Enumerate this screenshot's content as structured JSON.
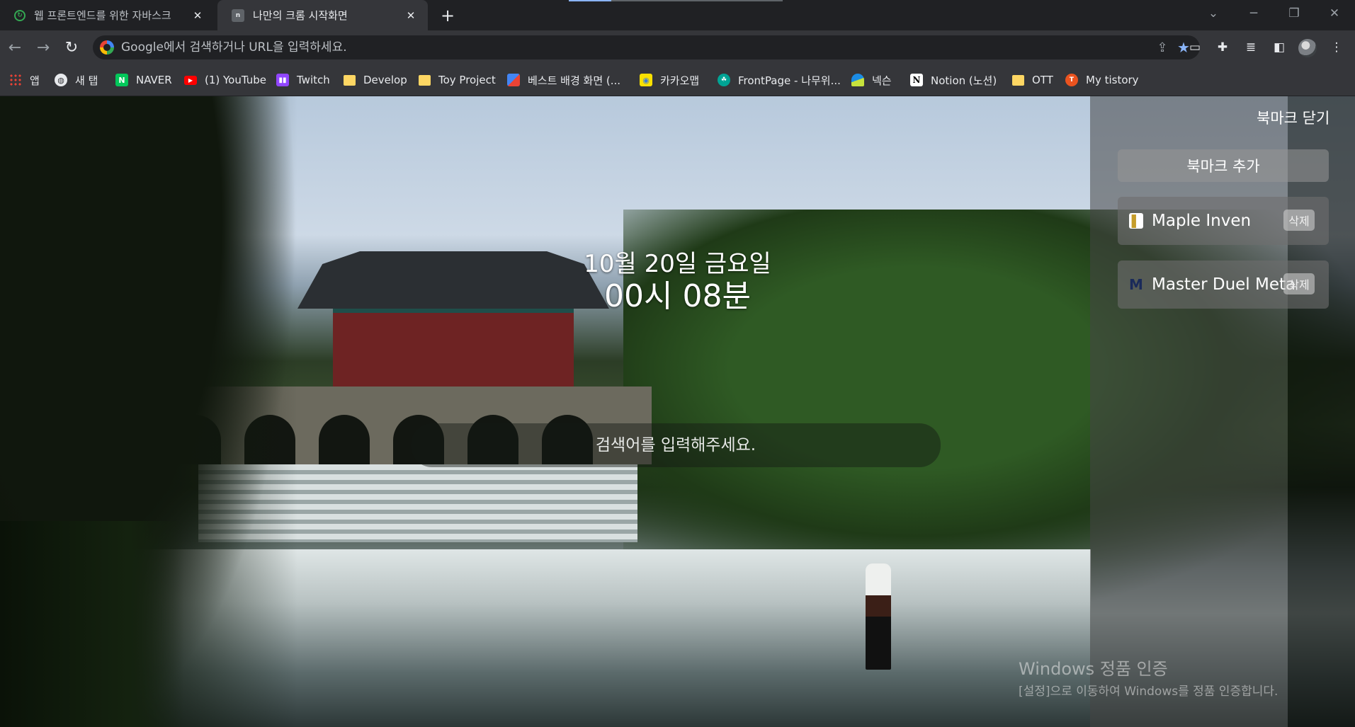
{
  "tabs": [
    {
      "title": "웹 프론트엔드를 위한 자바스크",
      "favicon": "green-refresh-icon",
      "active": false
    },
    {
      "title": "나만의 크롬 시작화면",
      "favicon": "n-page-icon",
      "active": true
    }
  ],
  "omnibox": {
    "placeholder": "Google에서 검색하거나 URL을 입력하세요."
  },
  "bookmarks": [
    {
      "label": "앱",
      "icon": "apps-grid-icon"
    },
    {
      "label": "새 탭",
      "icon": "globe-icon"
    },
    {
      "label": "NAVER",
      "icon": "naver-icon"
    },
    {
      "label": "(1) YouTube",
      "icon": "youtube-icon"
    },
    {
      "label": "Twitch",
      "icon": "twitch-icon"
    },
    {
      "label": "Develop",
      "icon": "folder-icon"
    },
    {
      "label": "Toy Project",
      "icon": "folder-icon"
    },
    {
      "label": "베스트 배경 화면 (...",
      "icon": "wallpaper-icon"
    },
    {
      "label": "카카오맵",
      "icon": "kakaomap-icon"
    },
    {
      "label": "FrontPage - 나무위...",
      "icon": "namuwiki-icon"
    },
    {
      "label": "넥슨",
      "icon": "nexon-icon"
    },
    {
      "label": "Notion (노션)",
      "icon": "notion-icon"
    },
    {
      "label": "OTT",
      "icon": "folder-icon"
    },
    {
      "label": "My tistory",
      "icon": "tistory-icon"
    }
  ],
  "clock": {
    "date": "10월 20일 금요일",
    "time": "00시 08분"
  },
  "search": {
    "placeholder": "검색어를 입력해주세요."
  },
  "panel": {
    "close_label": "북마크 닫기",
    "add_label": "북마크 추가",
    "items": [
      {
        "name": "Maple Inven",
        "delete_label": "삭제",
        "icon": "inven-icon"
      },
      {
        "name": "Master Duel Meta",
        "delete_label": "삭제",
        "icon": "m-logo-icon"
      }
    ]
  },
  "watermark": {
    "title": "Windows 정품 인증",
    "subtitle": "[설정]으로 이동하여 Windows를 정품 인증합니다."
  },
  "colors": {
    "accent": "#8ab4f8",
    "tab_bg": "#202124",
    "toolbar_bg": "#35363a"
  }
}
